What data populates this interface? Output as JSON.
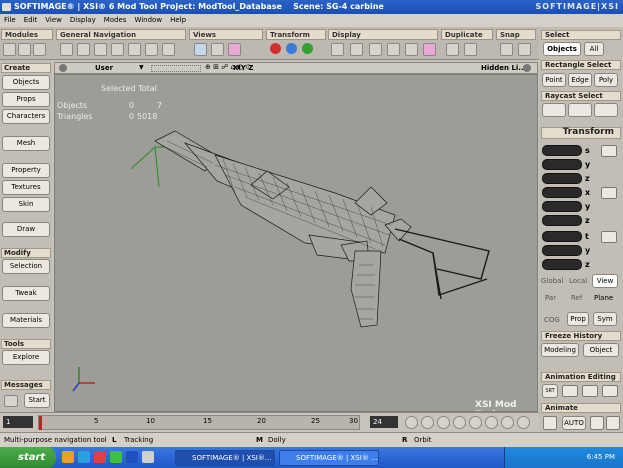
{
  "title": {
    "app": "SOFTIMAGE® | XSI® 6 Mod Tool Project: ModTool_Database",
    "scene": "Scene: SG-4 carbine",
    "brand": "SOFTIMAGE|XSI"
  },
  "menu": [
    "File",
    "Edit",
    "View",
    "Display",
    "Modes",
    "Window",
    "Help"
  ],
  "toolbar_sections": [
    "Modules",
    "General Navigation",
    "Views",
    "Transform",
    "Display",
    "Duplicate",
    "Snap"
  ],
  "select": {
    "header": "Select",
    "objects": "Objects",
    "all": "All"
  },
  "left": {
    "create": "Create",
    "objects": "Objects",
    "props": "Props",
    "characters": "Characters",
    "mesh": "Mesh",
    "property": "Property",
    "textures": "Textures",
    "skin": "Skin",
    "draw": "Draw",
    "modify": "Modify",
    "selection": "Selection",
    "tweak": "Tweak",
    "materials": "Materials",
    "tools": "Tools",
    "explore": "Explore",
    "messages": "Messages",
    "start": "Start"
  },
  "viewport": {
    "view_name": "User",
    "axes": "X Y Z",
    "hidden": "Hidden Li...",
    "stats_header": "Selected Total",
    "objects_label": "Objects",
    "objects_sel": "0",
    "objects_total": "7",
    "triangles_label": "Triangles",
    "triangles_sel": "0",
    "triangles_total": "5018",
    "watermark": "XSI Mod Tool"
  },
  "right": {
    "rect_select": "Rectangle Select",
    "point": "Point",
    "edge": "Edge",
    "poly": "Poly",
    "raycast": "Raycast Select",
    "transform": "Transform",
    "s": "s",
    "x": "x",
    "y": "y",
    "z": "z",
    "t": "t",
    "global": "Global",
    "local": "Local",
    "view": "View",
    "par": "Par",
    "ref": "Ref",
    "plane": "Plane",
    "cog": "COG",
    "prop": "Prop",
    "sym": "Sym",
    "freeze_history": "Freeze History",
    "modeling": "Modeling",
    "object": "Object",
    "anim_editing": "Animation Editing",
    "srt": "SRT",
    "animate": "Animate",
    "auto": "AUTO"
  },
  "timeline": {
    "start": "1",
    "ticks": [
      "5",
      "10",
      "15",
      "20",
      "25",
      "30"
    ],
    "current_frame": "24"
  },
  "status": {
    "message": "Multi-purpose navigation tool",
    "l": "L",
    "tracking": "Tracking",
    "m": "M",
    "dolly": "Dolly",
    "r": "R",
    "orbit": "Orbit"
  },
  "taskbar": {
    "start": "start",
    "task1": "SOFTIMAGE® | XSI®...",
    "task2": "SOFTIMAGE® | XSI® ...",
    "time": "6:45 PM"
  }
}
